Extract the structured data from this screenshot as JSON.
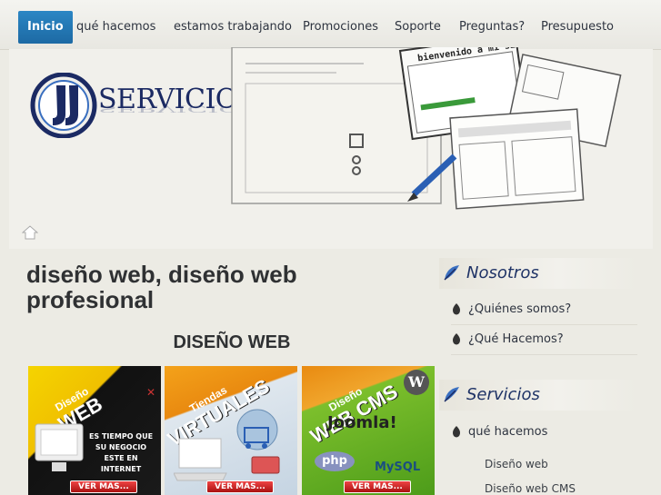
{
  "nav": {
    "items": [
      {
        "label": "Inicio"
      },
      {
        "label": "qué hacemos"
      },
      {
        "label": "estamos trabajando"
      },
      {
        "label": "Promociones"
      },
      {
        "label": "Soporte"
      },
      {
        "label": "Preguntas?"
      },
      {
        "label": "Presupuesto"
      }
    ]
  },
  "header": {
    "logo_text": "SERVICIOS",
    "banner_sketch_text": "bienvenido a mi sitio"
  },
  "main": {
    "title": "diseño web, diseño web profesional",
    "section_heading": "DISEÑO WEB",
    "promos": [
      {
        "ribbon_small": "Diseño",
        "ribbon_big": "WEB",
        "caption": "ES TIEMPO QUE SU NEGOCIO ESTE EN INTERNET",
        "button": "VER MAS..."
      },
      {
        "ribbon_small": "Tiendas",
        "ribbon_big": "VIRTUALES",
        "button": "VER MAS..."
      },
      {
        "ribbon_small": "Diseño",
        "ribbon_big": "WEB CMS",
        "logo1": "Joomla!",
        "logo2": "php",
        "logo3": "MySQL",
        "button": "VER MAS..."
      }
    ]
  },
  "sidebar": {
    "nosotros": {
      "heading": "Nosotros",
      "links": [
        "¿Quiénes somos?",
        "¿Qué Hacemos?"
      ]
    },
    "servicios": {
      "heading": "Servicios",
      "links": [
        "qué hacemos"
      ],
      "sublinks": [
        "Diseño web",
        "Diseño web CMS"
      ]
    }
  },
  "colors": {
    "accent": "#1d6aa4",
    "brand_navy": "#1b2a63",
    "background": "#ecebe4"
  }
}
